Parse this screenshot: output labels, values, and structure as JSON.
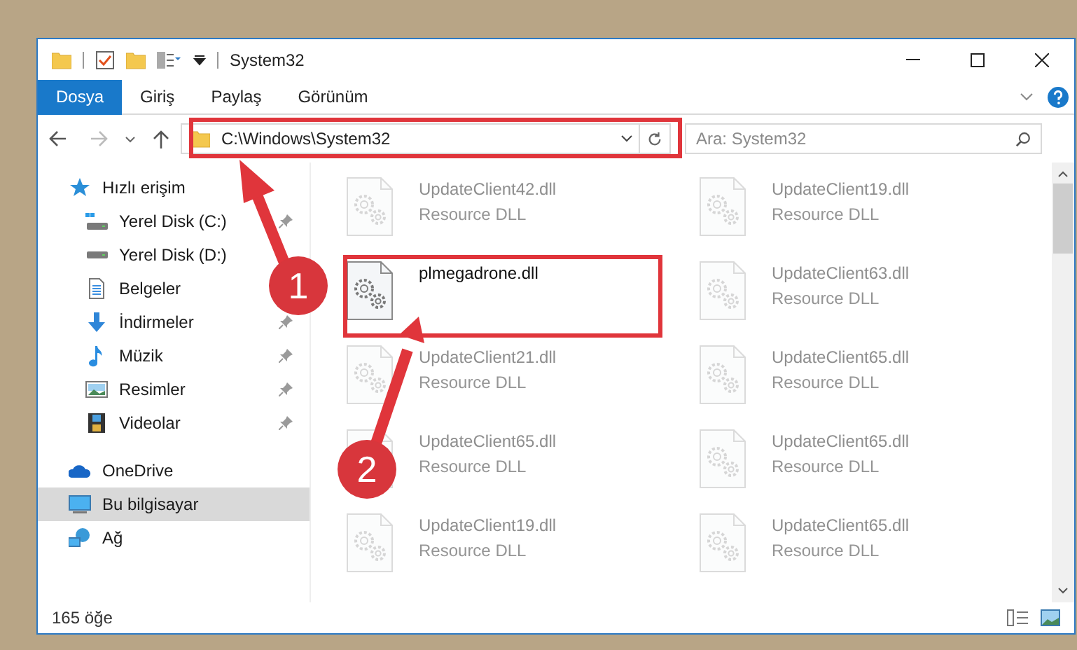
{
  "window": {
    "title": "System32"
  },
  "ribbon_tabs": [
    {
      "label": "Dosya",
      "kind": "menu"
    },
    {
      "label": "Giriş",
      "kind": "tab"
    },
    {
      "label": "Paylaş",
      "kind": "tab"
    },
    {
      "label": "Görünüm",
      "kind": "tab"
    }
  ],
  "address_bar": {
    "path": "C:\\Windows\\System32"
  },
  "search": {
    "placeholder": "Ara: System32"
  },
  "navigation": [
    {
      "label": "Hızlı erişim",
      "kind": "quick",
      "selected": false,
      "children": [
        {
          "label": "Yerel Disk (C:)",
          "kind": "drive_c",
          "pinned": true
        },
        {
          "label": "Yerel Disk (D:)",
          "kind": "drive"
        },
        {
          "label": "Belgeler",
          "kind": "documents"
        },
        {
          "label": "İndirmeler",
          "kind": "downloads",
          "pinned": true
        },
        {
          "label": "Müzik",
          "kind": "music",
          "pinned": true
        },
        {
          "label": "Resimler",
          "kind": "pictures",
          "pinned": true
        },
        {
          "label": "Videolar",
          "kind": "videos",
          "pinned": true
        }
      ]
    },
    {
      "label": "OneDrive",
      "kind": "cloud",
      "selected": false
    },
    {
      "label": "Bu bilgisayar",
      "kind": "computer",
      "selected": true
    },
    {
      "label": "Ağ",
      "kind": "network",
      "selected": false
    }
  ],
  "files": [
    {
      "name": "UpdateClient42.dll",
      "type": "Resource DLL",
      "faded": true
    },
    {
      "name": "UpdateClient19.dll",
      "type": "Resource DLL",
      "faded": true
    },
    {
      "name": "plmegadrone.dll",
      "faded": false
    },
    {
      "name": "UpdateClient63.dll",
      "type": "Resource DLL",
      "faded": true
    },
    {
      "name": "UpdateClient21.dll",
      "type": "Resource DLL",
      "faded": true
    },
    {
      "name": "UpdateClient65.dll",
      "type": "Resource DLL",
      "faded": true
    },
    {
      "name": "UpdateClient65.dll",
      "type": "Resource DLL",
      "faded": true
    },
    {
      "name": "UpdateClient65.dll",
      "type": "Resource DLL",
      "faded": true
    },
    {
      "name": "UpdateClient19.dll",
      "type": "Resource DLL",
      "faded": true
    },
    {
      "name": "UpdateClient65.dll",
      "type": "Resource DLL",
      "faded": true
    }
  ],
  "status_bar": {
    "item_count": "165 öğe"
  },
  "annotations": [
    {
      "number": "1"
    },
    {
      "number": "2"
    }
  ]
}
